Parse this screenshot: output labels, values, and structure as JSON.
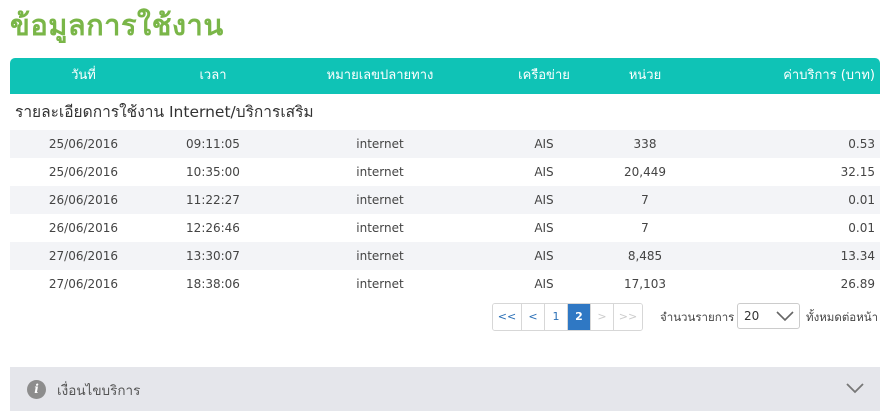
{
  "title": "ข้อมูลการใช้งาน",
  "table": {
    "headers": {
      "date": "วันที่",
      "time": "เวลา",
      "number": "หมายเลขปลายทาง",
      "network": "เครือข่าย",
      "unit": "หน่วย",
      "cost": "ค่าบริการ (บาท)"
    },
    "section_title": "รายละเอียดการใช้งาน Internet/บริการเสริม",
    "rows": [
      {
        "date": "25/06/2016",
        "time": "09:11:05",
        "number": "internet",
        "network": "AIS",
        "unit": "338",
        "cost": "0.53"
      },
      {
        "date": "25/06/2016",
        "time": "10:35:00",
        "number": "internet",
        "network": "AIS",
        "unit": "20,449",
        "cost": "32.15"
      },
      {
        "date": "26/06/2016",
        "time": "11:22:27",
        "number": "internet",
        "network": "AIS",
        "unit": "7",
        "cost": "0.01"
      },
      {
        "date": "26/06/2016",
        "time": "12:26:46",
        "number": "internet",
        "network": "AIS",
        "unit": "7",
        "cost": "0.01"
      },
      {
        "date": "27/06/2016",
        "time": "13:30:07",
        "number": "internet",
        "network": "AIS",
        "unit": "8,485",
        "cost": "13.34"
      },
      {
        "date": "27/06/2016",
        "time": "18:38:06",
        "number": "internet",
        "network": "AIS",
        "unit": "17,103",
        "cost": "26.89"
      }
    ]
  },
  "pagination": {
    "first": "<<",
    "prev": "<",
    "pages": [
      "1",
      "2"
    ],
    "current_page": "2",
    "next": ">",
    "last": ">>",
    "label_before": "จำนวนรายการ",
    "per_page_value": "20",
    "label_after": "ทั้งหมดต่อหน้า"
  },
  "notice": {
    "label": "เงื่อนไขบริการ",
    "icon": "info-icon"
  },
  "colors": {
    "title": "#7ab648",
    "header_bg": "#0fc3b6",
    "active_page": "#2f78c4"
  }
}
